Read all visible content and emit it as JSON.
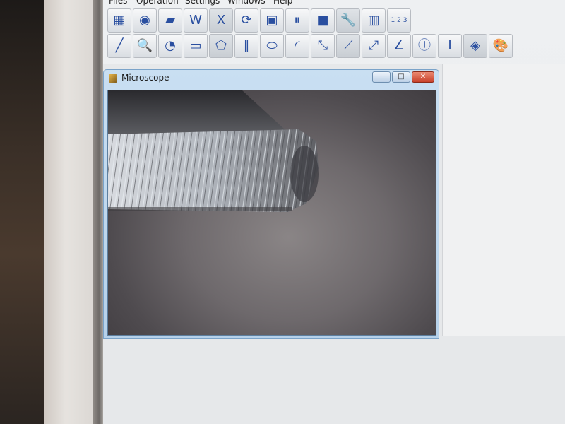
{
  "menu": {
    "files": "Files",
    "operation": "Operation",
    "settings": "Settings",
    "windows": "Windows",
    "help": "Help"
  },
  "toolbar_top": [
    {
      "name": "video-icon",
      "glyph": "▦"
    },
    {
      "name": "camera-icon",
      "glyph": "◉"
    },
    {
      "name": "open-folder-icon",
      "glyph": "▰"
    },
    {
      "name": "word-export-icon",
      "glyph": "W"
    },
    {
      "name": "excel-export-icon",
      "glyph": "X"
    },
    {
      "name": "refresh-icon",
      "glyph": "⟳"
    },
    {
      "name": "save-icon",
      "glyph": "▣"
    },
    {
      "name": "pause-icon",
      "glyph": "⏸"
    },
    {
      "name": "stop-icon",
      "glyph": "■"
    },
    {
      "name": "wrench-icon",
      "glyph": "🔧"
    },
    {
      "name": "scale-icon",
      "glyph": "▥"
    },
    {
      "name": "ruler-icon",
      "glyph": "1 2 3"
    }
  ],
  "toolbar_bottom": [
    {
      "name": "line-tool-icon",
      "glyph": "╱"
    },
    {
      "name": "magnifier-icon",
      "glyph": "🔍"
    },
    {
      "name": "circle-select-icon",
      "glyph": "◔"
    },
    {
      "name": "rectangle-tool-icon",
      "glyph": "▭"
    },
    {
      "name": "polygon-tool-icon",
      "glyph": "⬠"
    },
    {
      "name": "parallel-lines-icon",
      "glyph": "∥"
    },
    {
      "name": "ellipse-tool-icon",
      "glyph": "⬭"
    },
    {
      "name": "arc-tool-icon",
      "glyph": "◜"
    },
    {
      "name": "distance-tool-icon",
      "glyph": "⤡"
    },
    {
      "name": "point-line-icon",
      "glyph": "⟋"
    },
    {
      "name": "parallel-distance-icon",
      "glyph": "⤢"
    },
    {
      "name": "angle-tool-icon",
      "glyph": "∠"
    },
    {
      "name": "circle-marker-icon",
      "glyph": "Ⓘ"
    },
    {
      "name": "text-marker-icon",
      "glyph": "Ⅰ"
    },
    {
      "name": "diamond-marker-icon",
      "glyph": "◈"
    },
    {
      "name": "palette-icon",
      "glyph": "🎨"
    }
  ],
  "child_window": {
    "title": "Microscope",
    "minimize": "─",
    "maximize": "□",
    "close": "✕"
  },
  "colors": {
    "title_bar": "#c9dff2",
    "viewport_background": "#6e696c",
    "specimen": "#b9bcc1"
  }
}
